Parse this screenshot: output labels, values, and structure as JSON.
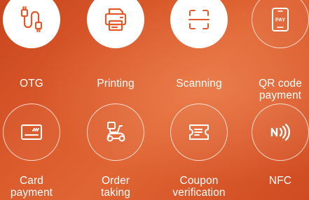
{
  "features": {
    "otg": {
      "label": "OTG",
      "icon": "usb-cable-icon"
    },
    "printing": {
      "label": "Printing",
      "icon": "printer-icon"
    },
    "scanning": {
      "label": "Scanning",
      "icon": "scan-frame-icon"
    },
    "qr_payment": {
      "line1": "QR code",
      "line2": "payment",
      "icon": "pay-phone-icon",
      "pay_text": "PAY"
    },
    "card_payment": {
      "line1": "Card",
      "line2": "payment",
      "icon": "card-icon"
    },
    "order_taking": {
      "line1": "Order",
      "line2": "taking",
      "icon": "delivery-scooter-icon"
    },
    "coupon_verification": {
      "line1": "Coupon",
      "line2": "verification",
      "icon": "coupon-ticket-icon"
    },
    "nfc": {
      "label": "NFC",
      "icon": "nfc-icon"
    }
  },
  "colors": {
    "background_start": "#c9451d",
    "background_end": "#e06534",
    "icon_orange": "#e25a2a",
    "text": "#ffffff"
  }
}
